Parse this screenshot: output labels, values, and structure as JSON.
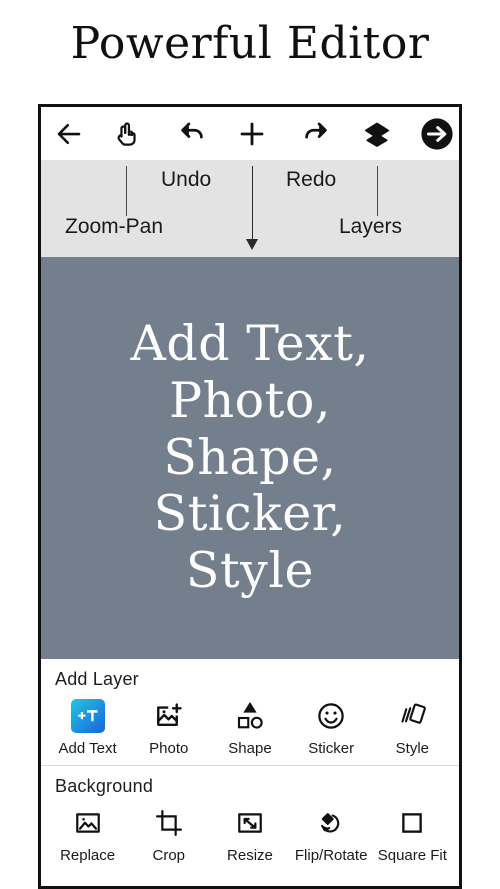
{
  "headline": "Powerful Editor",
  "toolbar": {
    "items": [
      {
        "name": "back-arrow-icon",
        "label": "Back"
      },
      {
        "name": "hand-pan-icon",
        "label": "Zoom-Pan"
      },
      {
        "name": "undo-icon",
        "label": "Undo"
      },
      {
        "name": "plus-add-icon",
        "label": "Add"
      },
      {
        "name": "redo-icon",
        "label": "Redo"
      },
      {
        "name": "layers-icon",
        "label": "Layers"
      },
      {
        "name": "next-arrow-circle-icon",
        "label": "Next"
      }
    ]
  },
  "annotations": {
    "zoom_pan": "Zoom-Pan",
    "undo": "Undo",
    "redo": "Redo",
    "layers": "Layers"
  },
  "canvas": {
    "background_color": "#737f8c",
    "text_color": "#fdfdfd",
    "lines": [
      "Add Text,",
      "Photo,",
      "Shape,",
      "Sticker,",
      "Style"
    ]
  },
  "add_layer": {
    "title": "Add Layer",
    "items": [
      {
        "label": "Add Text",
        "icon": "add-text-icon",
        "selected": true,
        "accent": "#1e8fe0"
      },
      {
        "label": "Photo",
        "icon": "photo-add-icon",
        "selected": false
      },
      {
        "label": "Shape",
        "icon": "shape-icon",
        "selected": false
      },
      {
        "label": "Sticker",
        "icon": "sticker-smiley-icon",
        "selected": false
      },
      {
        "label": "Style",
        "icon": "style-cards-icon",
        "selected": false
      }
    ]
  },
  "background_panel": {
    "title": "Background",
    "items": [
      {
        "label": "Replace",
        "icon": "image-replace-icon"
      },
      {
        "label": "Crop",
        "icon": "crop-icon"
      },
      {
        "label": "Resize",
        "icon": "resize-icon"
      },
      {
        "label": "Flip/Rotate",
        "icon": "flip-rotate-icon"
      },
      {
        "label": "Square Fit",
        "icon": "square-fit-icon"
      }
    ]
  }
}
